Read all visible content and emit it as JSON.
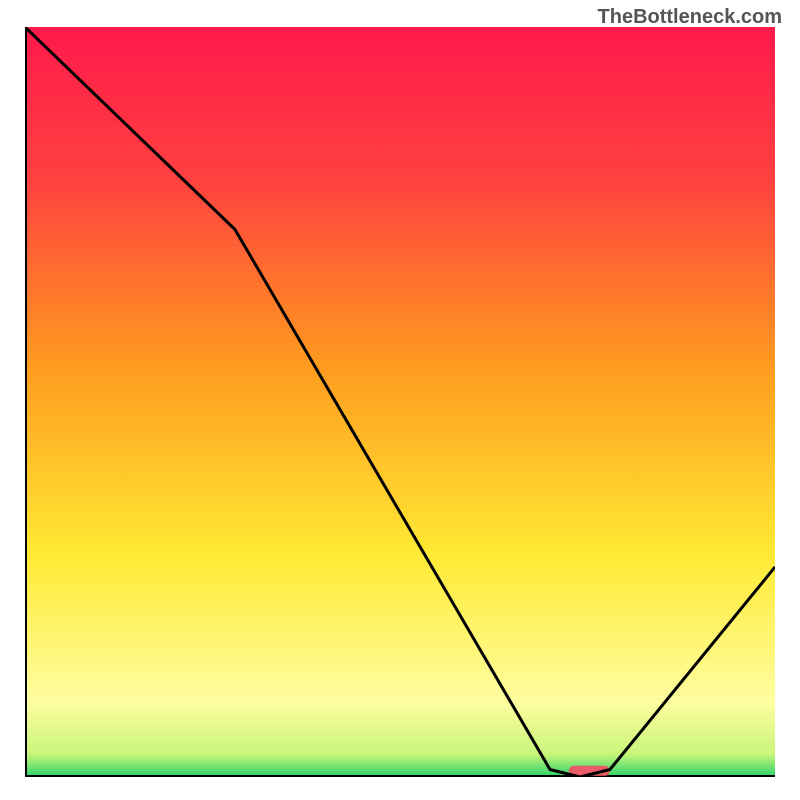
{
  "watermark": "TheBottleneck.com",
  "chart_data": {
    "type": "line",
    "title": "",
    "xlabel": "",
    "ylabel": "",
    "xlim": [
      0,
      100
    ],
    "ylim": [
      0,
      100
    ],
    "grid": false,
    "legend": false,
    "annotations": [],
    "series": [
      {
        "name": "curve",
        "x": [
          0,
          28,
          70,
          74,
          78,
          100
        ],
        "values": [
          100,
          73,
          1,
          0,
          1,
          28
        ]
      }
    ],
    "marker": {
      "x_start": 72.5,
      "x_end": 78.0,
      "y": 0.3,
      "color": "#e95d6a"
    },
    "background_gradient": {
      "type": "vertical",
      "stops": [
        {
          "pos": 0.0,
          "color": "#ff1a4b"
        },
        {
          "pos": 0.2,
          "color": "#ff4040"
        },
        {
          "pos": 0.45,
          "color": "#ff9a1f"
        },
        {
          "pos": 0.7,
          "color": "#ffe933"
        },
        {
          "pos": 0.9,
          "color": "#fffea0"
        },
        {
          "pos": 0.97,
          "color": "#c8f57a"
        },
        {
          "pos": 1.0,
          "color": "#27d36a"
        }
      ]
    },
    "axis_color": "#000000"
  }
}
